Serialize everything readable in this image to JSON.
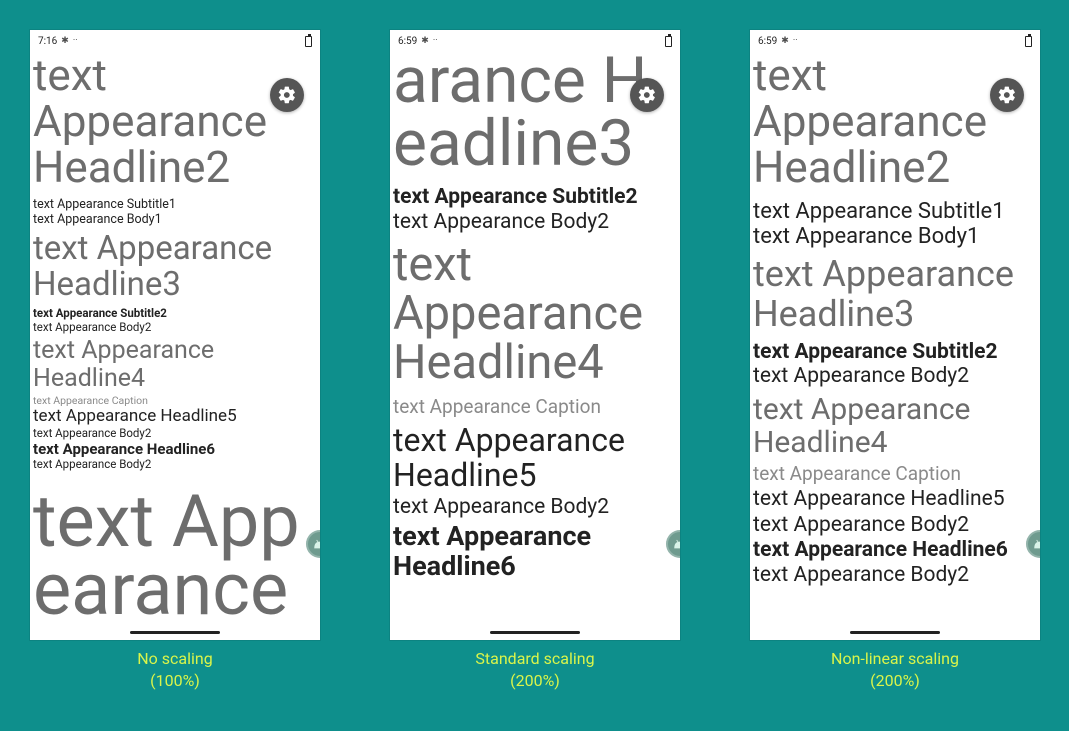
{
  "panels": [
    {
      "caption_line1": "No scaling",
      "caption_line2": "(100%)",
      "status_time": "7:16",
      "lines": [
        {
          "text": "text Appearance Headline2",
          "cls": "h-gray",
          "size": 44,
          "lh": 1.05,
          "mt": 0
        },
        {
          "text": "text Appearance Subtitle1",
          "cls": "h-dark",
          "size": 12.5,
          "lh": 1.2,
          "mt": 6
        },
        {
          "text": "text Appearance Body1",
          "cls": "h-dark",
          "size": 12.5,
          "lh": 1.2,
          "mt": 0
        },
        {
          "text": "text Appearance Headline3",
          "cls": "h-gray",
          "size": 33,
          "lh": 1.1,
          "mt": 4
        },
        {
          "text": "text Appearance Subtitle2",
          "cls": "h-bold",
          "size": 11.5,
          "lh": 1.2,
          "mt": 4
        },
        {
          "text": "text Appearance Body2",
          "cls": "h-dark",
          "size": 11.5,
          "lh": 1.2,
          "mt": 0
        },
        {
          "text": "text Appearance Headline4",
          "cls": "h-gray",
          "size": 25,
          "lh": 1.12,
          "mt": 2
        },
        {
          "text": "text Appearance Caption",
          "cls": "cap",
          "size": 10.5,
          "lh": 1.2,
          "mt": 2
        },
        {
          "text": "text Appearance Headline5",
          "cls": "h-dark",
          "size": 17,
          "lh": 1.15,
          "mt": 0
        },
        {
          "text": "text Appearance Body2",
          "cls": "h-dark",
          "size": 11.5,
          "lh": 1.2,
          "mt": 0
        },
        {
          "text": "text Appearance Headline6",
          "cls": "h-bold",
          "size": 15,
          "lh": 1.15,
          "mt": 0
        },
        {
          "text": "text Appearance Body2",
          "cls": "h-dark",
          "size": 11.5,
          "lh": 1.2,
          "mt": 0
        },
        {
          "text": "text App earance",
          "cls": "h-gray",
          "size": 72,
          "lh": 0.95,
          "mt": 16
        }
      ]
    },
    {
      "caption_line1": "Standard scaling",
      "caption_line2": "(200%)",
      "status_time": "6:59",
      "lines": [
        {
          "text": "arance H eadline3",
          "cls": "h-gray",
          "size": 64,
          "lh": 0.98,
          "mt": -2
        },
        {
          "text": "text Appearance Subtitle2",
          "cls": "h-bold",
          "size": 21,
          "lh": 1.15,
          "mt": 10
        },
        {
          "text": "text Appearance Body2",
          "cls": "h-dark",
          "size": 21,
          "lh": 1.15,
          "mt": 0
        },
        {
          "text": "text Appearance Headline4",
          "cls": "h-gray",
          "size": 47,
          "lh": 1.05,
          "mt": 6
        },
        {
          "text": "text Appearance Caption",
          "cls": "cap",
          "size": 19,
          "lh": 1.2,
          "mt": 8
        },
        {
          "text": "text Appearance Headline5",
          "cls": "h-dark",
          "size": 32,
          "lh": 1.1,
          "mt": 4
        },
        {
          "text": "text Appearance Body2",
          "cls": "h-dark",
          "size": 21,
          "lh": 1.2,
          "mt": 2
        },
        {
          "text": "text Appearance Headline6",
          "cls": "h-bold",
          "size": 27,
          "lh": 1.1,
          "mt": 2
        }
      ]
    },
    {
      "caption_line1": "Non-linear scaling",
      "caption_line2": "(200%)",
      "status_time": "6:59",
      "lines": [
        {
          "text": "text Appearance Headline2",
          "cls": "h-gray",
          "size": 44,
          "lh": 1.05,
          "mt": 0
        },
        {
          "text": "text Appearance Subtitle1",
          "cls": "h-dark",
          "size": 22,
          "lh": 1.15,
          "mt": 8
        },
        {
          "text": "text Appearance Body1",
          "cls": "h-dark",
          "size": 22,
          "lh": 1.15,
          "mt": 0
        },
        {
          "text": "text Appearance Headline3",
          "cls": "h-gray",
          "size": 36,
          "lh": 1.1,
          "mt": 6
        },
        {
          "text": "text Appearance Subtitle2",
          "cls": "h-bold",
          "size": 21,
          "lh": 1.15,
          "mt": 6
        },
        {
          "text": "text Appearance Body2",
          "cls": "h-dark",
          "size": 21,
          "lh": 1.15,
          "mt": 0
        },
        {
          "text": "text Appearance Headline4",
          "cls": "h-gray",
          "size": 30,
          "lh": 1.1,
          "mt": 4
        },
        {
          "text": "text Appearance Caption",
          "cls": "cap",
          "size": 19,
          "lh": 1.2,
          "mt": 4
        },
        {
          "text": "text Appearance Headline5",
          "cls": "h-dark",
          "size": 21,
          "lh": 1.2,
          "mt": 2
        },
        {
          "text": "text Appearance Body2",
          "cls": "h-dark",
          "size": 21,
          "lh": 1.2,
          "mt": 0
        },
        {
          "text": "text Appearance Headline6",
          "cls": "h-bold",
          "size": 21,
          "lh": 1.2,
          "mt": 0
        },
        {
          "text": "text Appearance Body2",
          "cls": "h-dark",
          "size": 21,
          "lh": 1.2,
          "mt": 0
        }
      ]
    }
  ]
}
